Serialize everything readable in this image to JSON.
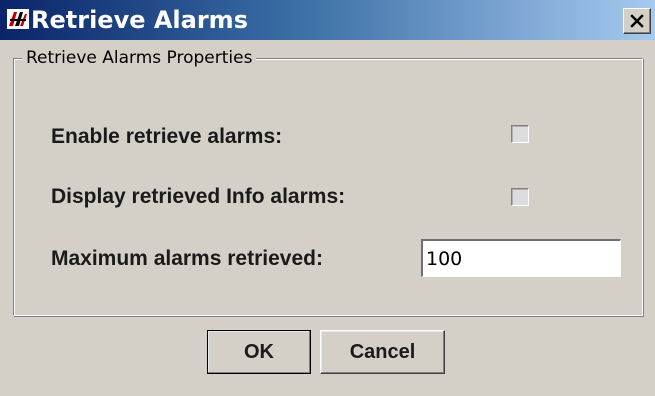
{
  "window": {
    "title": "Retrieve Alarms",
    "icon": "app-logo-icon",
    "close_icon": "close-icon"
  },
  "group": {
    "title": "Retrieve Alarms Properties"
  },
  "fields": {
    "enable_label": "Enable retrieve alarms:",
    "enable_checked": false,
    "display_info_label": "Display retrieved Info alarms:",
    "display_info_checked": false,
    "max_label": "Maximum alarms retrieved:",
    "max_value": "100"
  },
  "buttons": {
    "ok_label": "OK",
    "cancel_label": "Cancel"
  },
  "colors": {
    "titlebar_start": "#0a246a",
    "titlebar_end": "#a6caf0",
    "dialog_bg": "#d4d0c8"
  }
}
